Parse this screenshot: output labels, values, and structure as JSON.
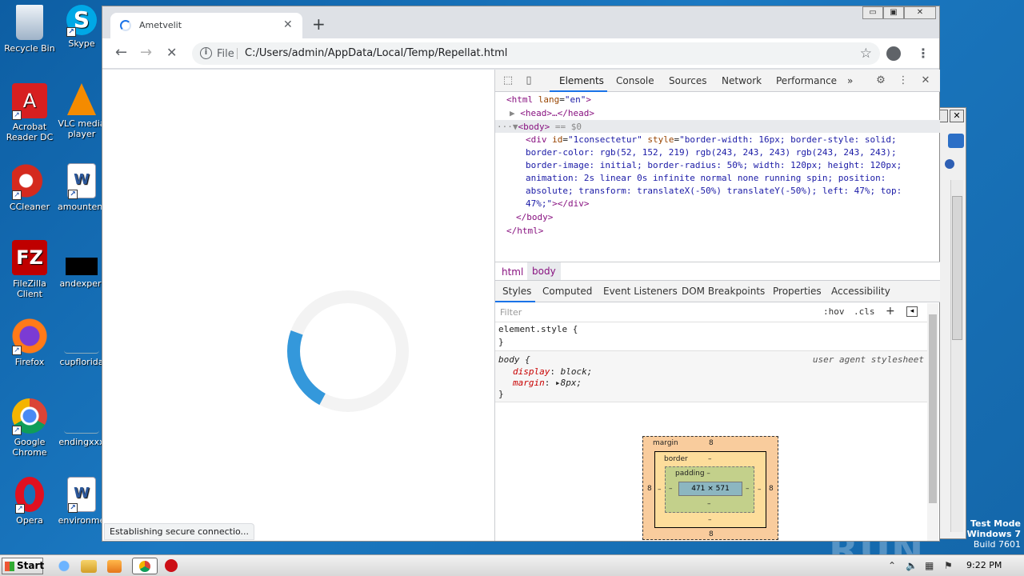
{
  "desktop": {
    "icons": [
      {
        "label": "Recycle Bin",
        "icon": "recycle-bin-icon"
      },
      {
        "label": "Skype",
        "icon": "skype-icon"
      },
      {
        "label": "Acrobat Reader DC",
        "icon": "acrobat-icon"
      },
      {
        "label": "VLC media player",
        "icon": "vlc-icon"
      },
      {
        "label": "CCleaner",
        "icon": "ccleaner-icon"
      },
      {
        "label": "amountenc",
        "icon": "word-doc-icon"
      },
      {
        "label": "FileZilla Client",
        "icon": "filezilla-icon"
      },
      {
        "label": "andexperi",
        "icon": "black-file-icon"
      },
      {
        "label": "Firefox",
        "icon": "firefox-icon"
      },
      {
        "label": "cupflorida",
        "icon": "blank-file-icon"
      },
      {
        "label": "Google Chrome",
        "icon": "chrome-icon"
      },
      {
        "label": "endingxxx",
        "icon": "blank-file-icon"
      },
      {
        "label": "Opera",
        "icon": "opera-icon"
      },
      {
        "label": "environme",
        "icon": "word-doc-icon"
      }
    ],
    "watermark": "ANY RUN",
    "test_mode": {
      "line1": "Test Mode",
      "line2": "Windows 7",
      "line3": "Build 7601"
    }
  },
  "browser": {
    "tab_title": "Ametvelit",
    "tab_close": "✕",
    "new_tab": "+",
    "window_controls": {
      "minimize": "▭",
      "maximize": "▣",
      "close": "✕"
    },
    "back": "←",
    "forward": "→",
    "reload": "✕",
    "address_scheme": "File",
    "address_url": "C:/Users/admin/AppData/Local/Temp/Repellat.html",
    "status_text": "Establishing secure connectio...",
    "loader_colors": {
      "track": "#f3f3f3",
      "arc": "#3498db"
    }
  },
  "devtools": {
    "tabs": [
      "Elements",
      "Console",
      "Sources",
      "Network",
      "Performance"
    ],
    "active_tab": "Elements",
    "more_tabs": "»",
    "dom": {
      "l1_open": "<html ",
      "l1_attr": "lang",
      "l1_val": "\"en\"",
      "l1_close": ">",
      "l2": "<head>…</head>",
      "l3_tag": "<body>",
      "l3_eq": " == $0",
      "l3_dots": "···",
      "l4_open": "<div ",
      "l4_attr1": "id",
      "l4_val1": "\"1consectetur\"",
      "l4_attr2": " style",
      "l4_val2a": "\"border-width: 16px; border-style: solid;",
      "l5": "border-color: rgb(52, 152, 219) rgb(243, 243, 243) rgb(243, 243, 243);",
      "l6": "border-image: initial; border-radius: 50%; width: 120px; height: 120px;",
      "l7": "animation: 2s linear 0s infinite normal none running spin; position:",
      "l8": "absolute; transform: translateX(-50%) translateY(-50%); left: 47%; top:",
      "l9_val": "47%;\"",
      "l9_close": "></div>",
      "l10": "</body>",
      "l11": "</html>"
    },
    "breadcrumbs": [
      "html",
      "body"
    ],
    "subtabs": [
      "Styles",
      "Computed",
      "Event Listeners",
      "DOM Breakpoints",
      "Properties",
      "Accessibility"
    ],
    "filter_placeholder": "Filter",
    "hov": ":hov",
    "cls": ".cls",
    "add": "+",
    "element_style_open": "element.style {",
    "element_style_close": "}",
    "body_rule_open": "body {",
    "body_rule_source": "user agent stylesheet",
    "body_prop1": "display",
    "body_val1": "block;",
    "body_prop2": "margin",
    "body_val2": "8px;",
    "body_rule_close": "}",
    "box_model": {
      "margin_label": "margin",
      "margin_top": "8",
      "margin_left": "8",
      "margin_right": "8",
      "margin_bottom": "8",
      "border_label": "border",
      "border_top": "–",
      "border_left": "–",
      "border_right": "–",
      "border_bottom": "–",
      "padding_label": "padding –",
      "padding_left": "–",
      "padding_right": "–",
      "padding_bottom": "–",
      "content": "471 × 571"
    }
  },
  "taskbar": {
    "start": "Start",
    "clock": "9:22 PM"
  }
}
